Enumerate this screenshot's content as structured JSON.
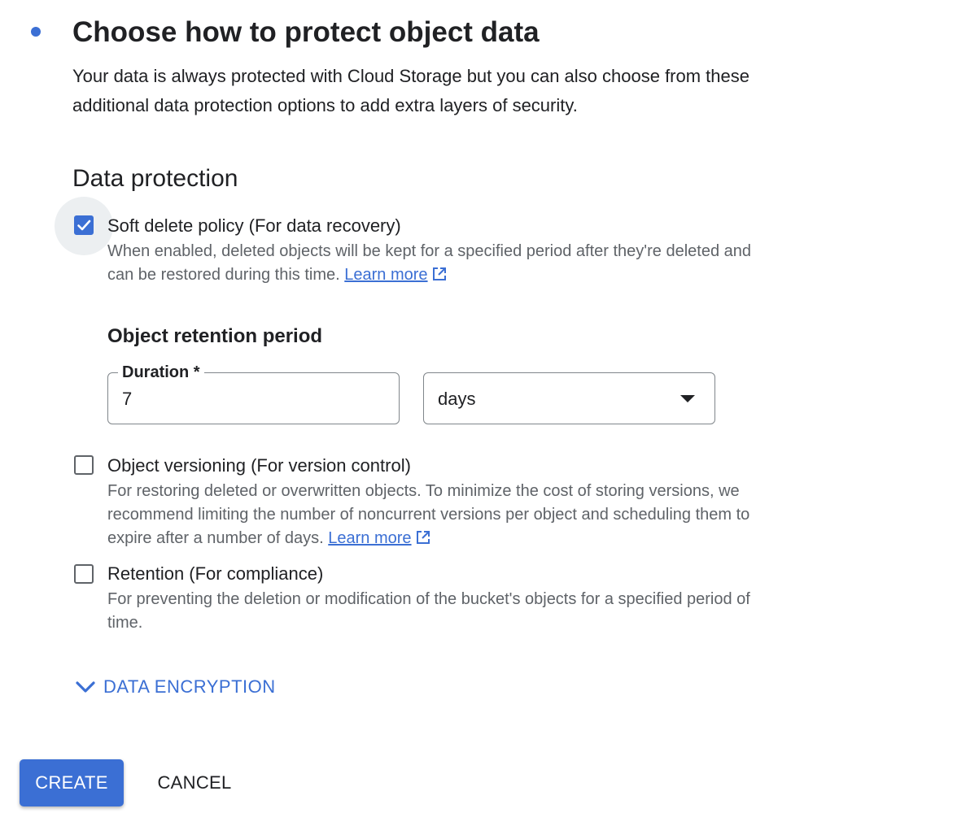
{
  "header": {
    "title": "Choose how to protect object data",
    "intro": "Your data is always protected with Cloud Storage but you can also choose from these additional data protection options to add extra layers of security."
  },
  "section_title": "Data protection",
  "options": [
    {
      "title": "Soft delete policy (For data recovery)",
      "description": "When enabled, deleted objects will be kept for a specified period after they're deleted and can be restored during this time.",
      "link": "Learn more",
      "checked": true
    },
    {
      "title": "Object versioning (For version control)",
      "description": "For restoring deleted or overwritten objects. To minimize the cost of storing versions, we recommend limiting the number of noncurrent versions per object and scheduling them to expire after a number of days.",
      "link": "Learn more",
      "checked": false
    },
    {
      "title": "Retention (For compliance)",
      "description": "For preventing the deletion or modification of the bucket's objects for a specified period of time.",
      "checked": false
    }
  ],
  "retention": {
    "heading": "Object retention period",
    "duration_label": "Duration *",
    "duration_value": "7",
    "unit_value": "days"
  },
  "encryption_toggle": "DATA ENCRYPTION",
  "actions": {
    "create": "CREATE",
    "cancel": "CANCEL"
  },
  "colors": {
    "accent": "#3b6fd4",
    "text": "#202124",
    "secondary_text": "#5f6368"
  },
  "icons": {
    "step": "step-dot-icon",
    "check": "check-icon",
    "external": "open-in-new-icon",
    "expand": "chevron-down-icon",
    "dropdown": "dropdown-arrow-icon"
  }
}
